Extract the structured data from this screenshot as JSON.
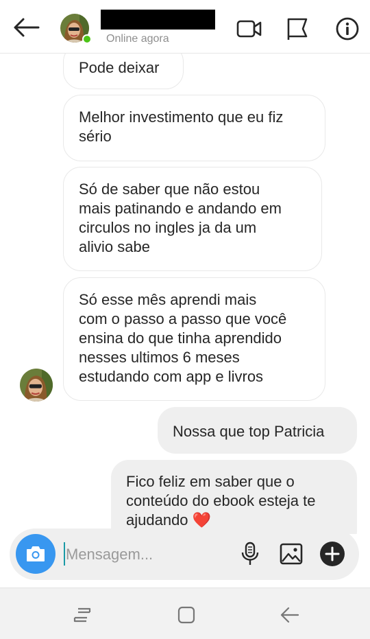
{
  "header": {
    "status": "Online agora",
    "icons": [
      "back-arrow-icon",
      "video-call-icon",
      "flag-icon",
      "info-icon"
    ]
  },
  "messages": [
    {
      "direction": "incoming",
      "lines": [
        "Pode deixar"
      ]
    },
    {
      "direction": "incoming",
      "lines": [
        "Melhor investimento que eu fiz",
        "sério"
      ]
    },
    {
      "direction": "incoming",
      "lines": [
        "Só de saber que não estou",
        "mais patinando e andando em",
        "circulos no ingles ja da um",
        "alivio sabe"
      ]
    },
    {
      "direction": "incoming",
      "lines": [
        "Só esse mês aprendi mais",
        "com o passo a passo que você",
        "ensina do que tinha aprendido",
        "nesses ultimos 6 meses",
        "estudando com app e livros"
      ]
    },
    {
      "direction": "outgoing",
      "lines": [
        "Nossa que top Patricia"
      ]
    },
    {
      "direction": "outgoing",
      "lines": [
        "Fico feliz em saber que o",
        "conteúdo do ebook esteja te",
        "ajudando ❤️"
      ]
    }
  ],
  "composer": {
    "placeholder": "Mensagem...",
    "value": "",
    "icons": [
      "camera-icon",
      "microphone-icon",
      "gallery-icon",
      "plus-icon"
    ]
  },
  "navbar": {
    "icons": [
      "recent-apps-icon",
      "home-icon",
      "back-nav-icon"
    ]
  },
  "colors": {
    "accent": "#3897f0",
    "online": "#4cc417",
    "outgoing_bubble": "#efefef",
    "incoming_border": "#e8e8e8",
    "heart": "#e0245e"
  }
}
